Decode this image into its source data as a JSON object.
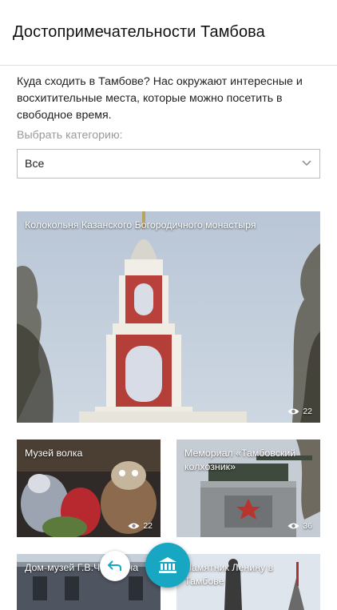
{
  "header": {
    "title": "Достопримечательности Тамбова"
  },
  "intro": "Куда сходить в Тамбове? Нас окружают интересные и восхитительные места, которые можно посетить в свободное время.",
  "category": {
    "label": "Выбрать категорию:",
    "selected": "Все"
  },
  "cards": [
    {
      "title": "Колокольня Казанского Богородичного монастыря",
      "views": "22"
    },
    {
      "title": "Музей волка",
      "views": "22"
    },
    {
      "title": "Мемориал «Тамбовский колхозник»",
      "views": "36"
    },
    {
      "title": "Дом-музей Г.В.Чичерина",
      "views": ""
    },
    {
      "title": "Памятник Ленину в Тамбове",
      "views": ""
    }
  ],
  "icons": {
    "back": "undo-arrow-icon",
    "fab": "museum-icon",
    "views": "eye-icon",
    "dropdown": "chevron-down-icon"
  },
  "colors": {
    "accent": "#17a7c3"
  }
}
